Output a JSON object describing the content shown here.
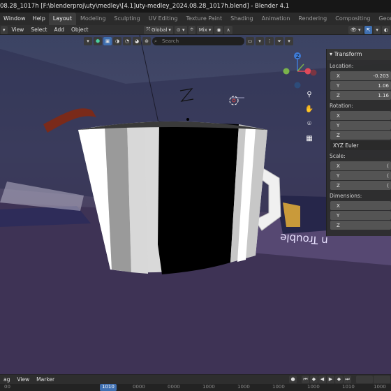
{
  "window": {
    "title": "08.28_1017h [F:\\blenderproj\\uty\\medley\\[4.1]uty-medley_2024.08.28_1017h.blend] - Blender 4.1"
  },
  "topbar": {
    "menus": [
      "Window",
      "Help"
    ],
    "workspaces": [
      {
        "label": "Layout",
        "active": true
      },
      {
        "label": "Modeling",
        "active": false
      },
      {
        "label": "Sculpting",
        "active": false
      },
      {
        "label": "UV Editing",
        "active": false
      },
      {
        "label": "Texture Paint",
        "active": false
      },
      {
        "label": "Shading",
        "active": false
      },
      {
        "label": "Animation",
        "active": false
      },
      {
        "label": "Rendering",
        "active": false
      },
      {
        "label": "Compositing",
        "active": false
      },
      {
        "label": "Geometry",
        "active": false
      }
    ]
  },
  "viewport_header": {
    "menus": [
      "View",
      "Select",
      "Add",
      "Object"
    ],
    "orientation": "Global",
    "mix_label": "Mix",
    "search_placeholder": "Search"
  },
  "scene_text": {
    "poster_text": "n Trouble"
  },
  "n_panel": {
    "header": "Transform",
    "location_label": "Location:",
    "location": [
      {
        "axis": "X",
        "value": "-0.203"
      },
      {
        "axis": "Y",
        "value": "1.06"
      },
      {
        "axis": "Z",
        "value": "1.16"
      }
    ],
    "rotation_label": "Rotation:",
    "rotation_mode": "XYZ Euler",
    "rotation": [
      {
        "axis": "X",
        "value": ""
      },
      {
        "axis": "Y",
        "value": ""
      },
      {
        "axis": "Z",
        "value": ""
      }
    ],
    "scale_label": "Scale:",
    "scale": [
      {
        "axis": "X",
        "value": "("
      },
      {
        "axis": "Y",
        "value": "("
      },
      {
        "axis": "Z",
        "value": "("
      }
    ],
    "dimensions_label": "Dimensions:",
    "dimensions": [
      {
        "axis": "X",
        "value": ""
      },
      {
        "axis": "Y",
        "value": ""
      },
      {
        "axis": "Z",
        "value": ""
      }
    ]
  },
  "timeline": {
    "menus": [
      "ag",
      "View",
      "Marker"
    ],
    "current_frame": "1010",
    "frame_numbers": [
      "00",
      "1010",
      "0000",
      "0000",
      "1000",
      "1000",
      "1000",
      "1000",
      "1010",
      "1000"
    ]
  },
  "colors": {
    "accent_blue": "#3f6fb0",
    "axis_x": "#e04a5a",
    "axis_y": "#7ab34b",
    "axis_z": "#3e7bd6"
  },
  "icons": {
    "transform_tool": "move-arrows-icon",
    "hand": "hand-pan-icon",
    "camera": "camera-icon",
    "grid": "grid-icon",
    "zoom": "magnifier-icon"
  }
}
